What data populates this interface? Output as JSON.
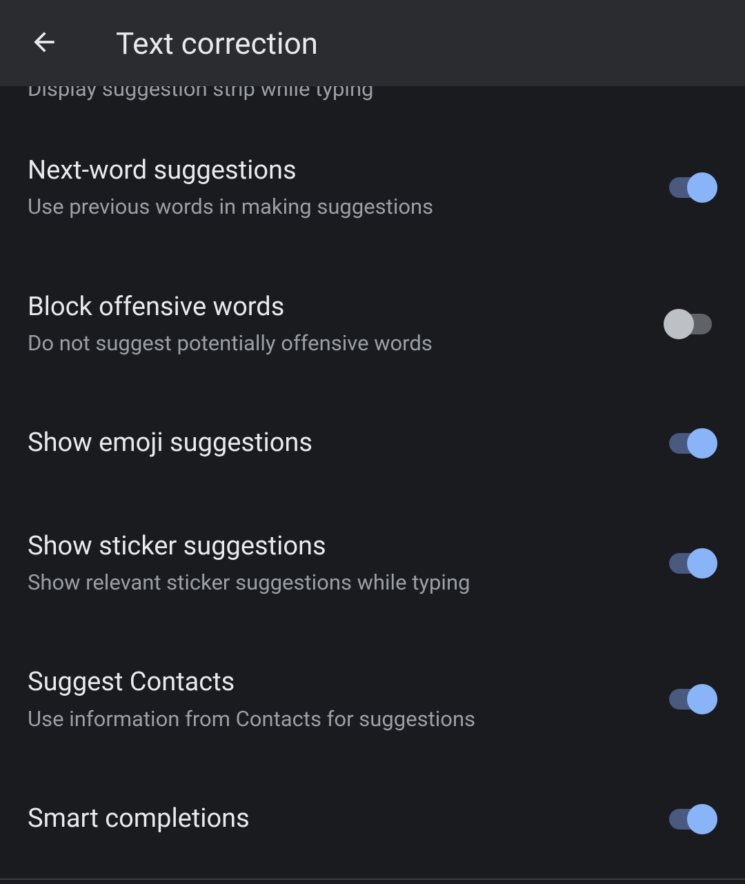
{
  "header": {
    "title": "Text correction"
  },
  "clipped": {
    "subtitle": "Display suggestion strip while typing"
  },
  "settings": [
    {
      "title": "Next-word suggestions",
      "subtitle": "Use previous words in making suggestions",
      "enabled": true
    },
    {
      "title": "Block offensive words",
      "subtitle": "Do not suggest potentially offensive words",
      "enabled": false
    },
    {
      "title": "Show emoji suggestions",
      "subtitle": "",
      "enabled": true
    },
    {
      "title": "Show sticker suggestions",
      "subtitle": "Show relevant sticker suggestions while typing",
      "enabled": true
    },
    {
      "title": "Suggest Contacts",
      "subtitle": "Use information from Contacts for suggestions",
      "enabled": true
    },
    {
      "title": "Smart completions",
      "subtitle": "",
      "enabled": true
    }
  ]
}
